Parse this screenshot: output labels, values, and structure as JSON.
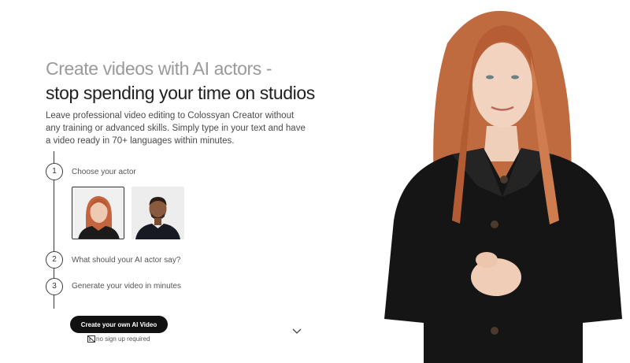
{
  "hero": {
    "title_light": "Create videos with AI actors -",
    "title_dark": "stop spending your time on studios",
    "description": "Leave professional video editing to Colossyan Creator without any training or advanced skills. Simply type in your text and have a video ready in 70+ languages within minutes."
  },
  "steps": [
    {
      "number": "1",
      "label": "Choose your actor"
    },
    {
      "number": "2",
      "label": "What should your AI actor say?"
    },
    {
      "number": "3",
      "label": "Generate your video in minutes"
    }
  ],
  "actors": [
    {
      "name": "female-redhead-actor",
      "selected": true
    },
    {
      "name": "male-actor",
      "selected": false
    }
  ],
  "cta": {
    "button_label": "Create your own AI Video",
    "note": "no sign up required"
  },
  "icons": {
    "note_icon": "card-icon",
    "scroll_icon": "chevron-down-icon"
  },
  "colors": {
    "cta_background": "#111111",
    "title_light": "#9a9a9a",
    "title_dark": "#1f1f1f"
  }
}
